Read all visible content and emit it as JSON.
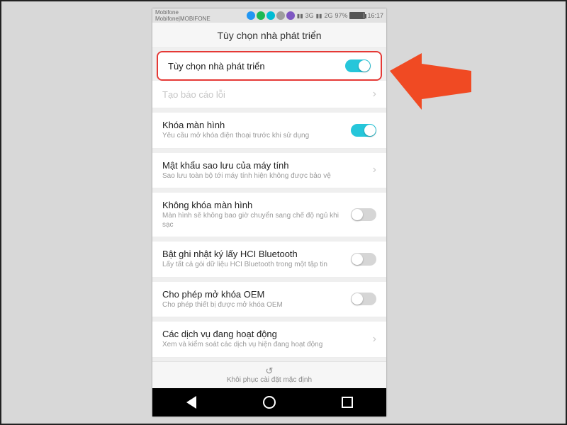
{
  "status": {
    "carrier1": "Mobifone",
    "carrier2": "Mobifone|MOBIFONE",
    "signal1": "3G",
    "signal2": "2G",
    "battery_pct": "97%",
    "time": "16:17"
  },
  "header": {
    "title": "Tùy chọn nhà phát triển"
  },
  "rows": {
    "dev_options": {
      "title": "Tùy chọn nhà phát triển",
      "toggle": true
    },
    "bug_report": {
      "title": "Tạo báo cáo lỗi"
    },
    "lock_screen": {
      "title": "Khóa màn hình",
      "sub": "Yêu cầu mở khóa điện thoại trước khi sử dụng",
      "toggle": true
    },
    "backup_pw": {
      "title": "Mật khẩu sao lưu của máy tính",
      "sub": "Sao lưu toàn bộ tới máy tính hiện không được bảo vệ"
    },
    "no_lock": {
      "title": "Không khóa màn hình",
      "sub": "Màn hình sẽ không bao giờ chuyển sang chế độ ngủ khi sạc",
      "toggle": false
    },
    "hci_bt": {
      "title": "Bật ghi nhật ký lấy HCI Bluetooth",
      "sub": "Lấy tất cả gói dữ liệu HCI Bluetooth trong một tập tin",
      "toggle": false
    },
    "oem": {
      "title": "Cho phép mở khóa OEM",
      "sub": "Cho phép thiết bị được mở khóa OEM",
      "toggle": false
    },
    "services": {
      "title": "Các dịch vụ đang hoạt động",
      "sub": "Xem và kiểm soát các dịch vụ hiện đang hoạt động"
    }
  },
  "restore": {
    "label": "Khôi phục cài đặt mặc định"
  }
}
